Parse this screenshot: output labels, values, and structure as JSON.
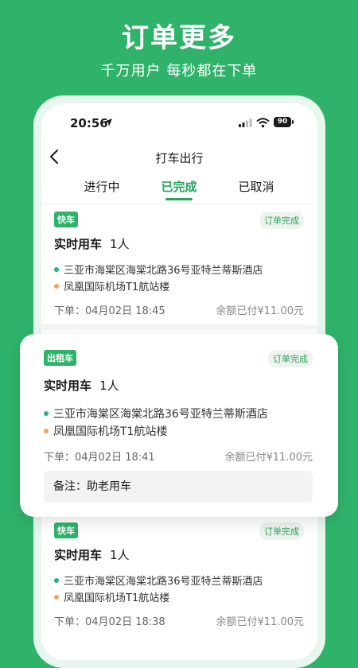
{
  "hero": {
    "title": "订单更多",
    "subtitle": "千万用户 每秒都在下单"
  },
  "status_bar": {
    "time": "20:56",
    "battery": "90"
  },
  "nav": {
    "title": "打车出行"
  },
  "tabs": [
    {
      "label": "进行中",
      "active": false
    },
    {
      "label": "已完成",
      "active": true
    },
    {
      "label": "已取消",
      "active": false
    }
  ],
  "orders": [
    {
      "badge": "快车",
      "status": "订单完成",
      "ride_type": "实时用车",
      "passengers": "1人",
      "from": "三亚市海棠区海棠北路36号亚特兰蒂斯酒店",
      "to": "凤凰国际机场T1航站楼",
      "time": "下单：04月02日 18:45",
      "paid": "余额已付¥11.00元"
    },
    {
      "badge": "出租车",
      "status": "订单完成",
      "ride_type": "实时用车",
      "passengers": "1人",
      "from": "三亚市海棠区海棠北路36号亚特兰蒂斯酒店",
      "to": "凤凰国际机场T1航站楼",
      "time": "下单：04月02日 18:41",
      "paid": "余额已付¥11.00元",
      "remark": "备注：助老用车"
    },
    {
      "badge": "快车",
      "status": "订单完成",
      "ride_type": "实时用车",
      "passengers": "1人",
      "from": "三亚市海棠区海棠北路36号亚特兰蒂斯酒店",
      "to": "凤凰国际机场T1航站楼",
      "time": "下单：04月02日 18:38",
      "paid": "余额已付¥11.00元"
    }
  ],
  "colors": {
    "background": "#2fb36b",
    "accent": "#2aa35d",
    "start_dot": "#22b383",
    "end_dot": "#f0a060"
  }
}
